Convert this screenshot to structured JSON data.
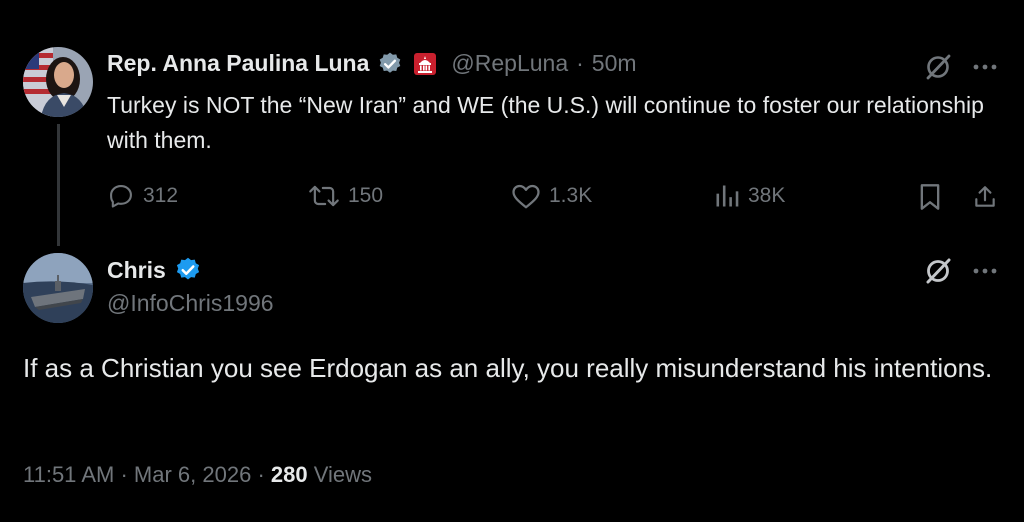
{
  "quoted_post": {
    "author_name": "Rep. Anna Paulina Luna",
    "handle": "@RepLuna",
    "separator": "·",
    "time": "50m",
    "text": "Turkey is NOT the “New Iran” and WE (the U.S.) will continue to foster our relationship with them.",
    "replies": "312",
    "reposts": "150",
    "likes": "1.3K",
    "views": "38K",
    "verified_badge_color": "#829aab",
    "affiliation_badge_color": "#c8202e"
  },
  "reply_post": {
    "author_name": "Chris",
    "handle": "@InfoChris1996",
    "text": "If as a Christian you see Erdogan as an ally, you really misunderstand his intentions.",
    "verified_badge_color": "#1d9bf0",
    "time": "11:51 AM",
    "sep1": "·",
    "date": "Mar 6, 2026",
    "sep2": "·",
    "views_count": "280",
    "views_label": "Views"
  },
  "icons": [
    "grok-icon",
    "more-icon",
    "reply-icon",
    "repost-icon",
    "like-icon",
    "views-icon",
    "bookmark-icon",
    "share-icon"
  ]
}
